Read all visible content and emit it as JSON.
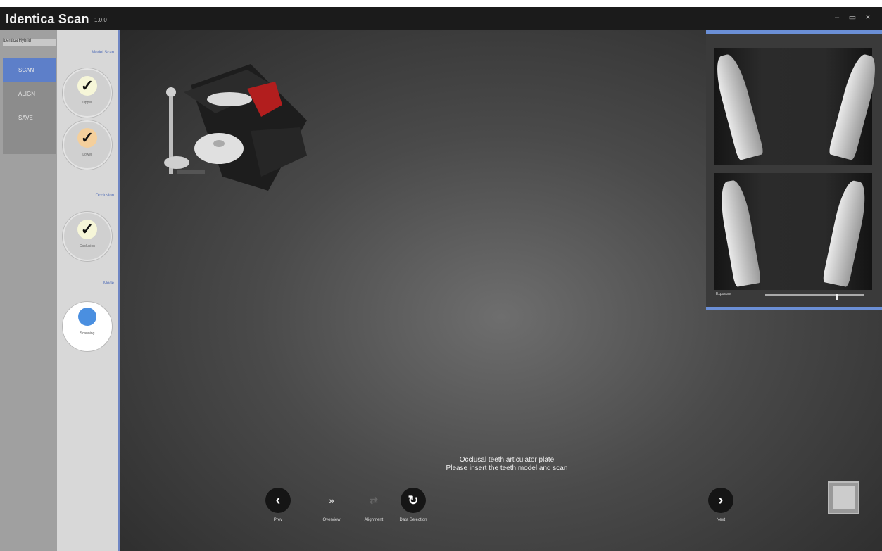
{
  "titlebar": {
    "title": "Identica Scan",
    "version": "1.0.0"
  },
  "window_controls": {
    "minimize": "–",
    "maximize": "▭",
    "close": "×"
  },
  "nav": {
    "header": "Identica Hybrid",
    "items": [
      {
        "label": "SCAN",
        "active": true
      },
      {
        "label": "ALIGN"
      },
      {
        "label": "SAVE"
      }
    ]
  },
  "steps": {
    "sections": [
      "Model Scan",
      "Occlusion",
      "Mode"
    ],
    "items": [
      {
        "label": "Upper",
        "icon": "check-icon"
      },
      {
        "label": "Lower",
        "icon": "check-icon"
      },
      {
        "label": "Occlusion",
        "icon": "check-icon"
      },
      {
        "label": "Scanning",
        "icon": "globe-icon"
      }
    ]
  },
  "preview": {
    "label": "Exposure"
  },
  "message": {
    "line1": "Occlusal teeth articulator plate",
    "line2": "Please insert the teeth model and scan"
  },
  "toolbar": {
    "prev": "Prev",
    "overview": "Overview",
    "alignment": "Alignment",
    "data_selection": "Data Selection",
    "next": "Next"
  },
  "colors": {
    "accent": "#6b8fd6",
    "nav_active": "#5d7fc9"
  }
}
